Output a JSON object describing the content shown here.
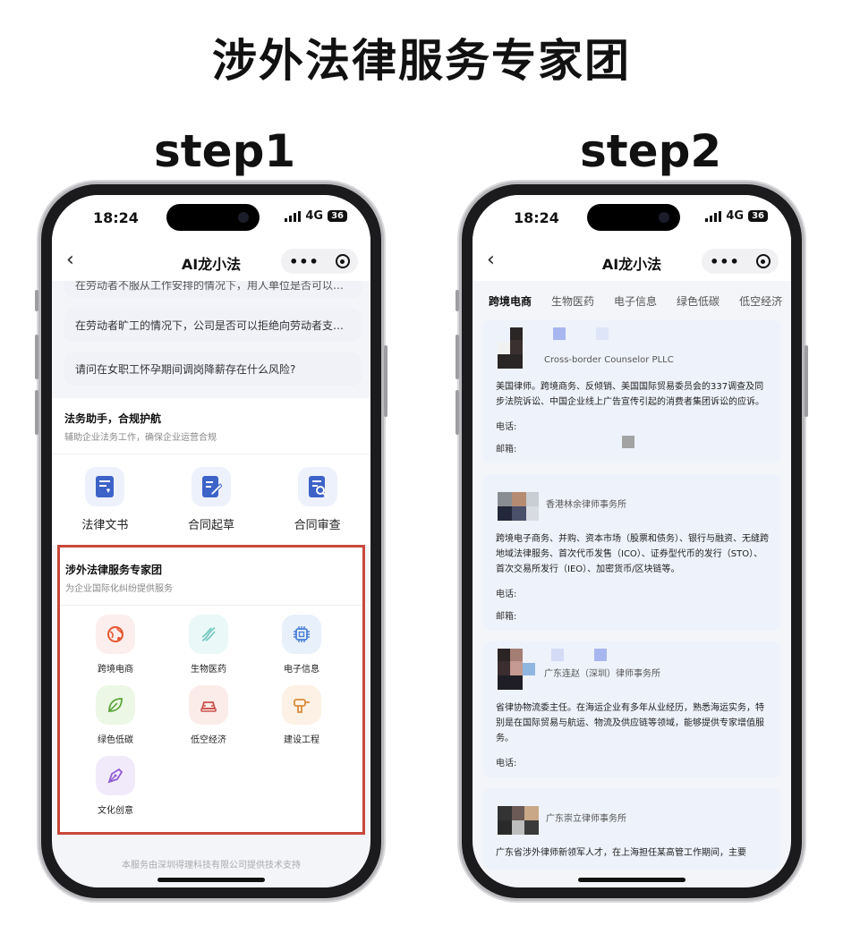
{
  "header": {
    "title": "涉外法律服务专家团",
    "step1": "step1",
    "step2": "step2"
  },
  "status_bar": {
    "time": "18:24",
    "network": "4G",
    "battery": "36"
  },
  "app": {
    "back_symbol": "‹",
    "title": "AI龙小法",
    "more_symbol": "•••"
  },
  "step1": {
    "question_partial": "在劳动者不服从工作安排的情况下，用人单位是否可以解…",
    "questions": [
      "在劳动者旷工的情况下，公司是否可以拒绝向劳动者支付…",
      "请问在女职工怀孕期间调岗降薪存在什么风险?"
    ],
    "assistant": {
      "title": "法务助手，合规护航",
      "subtitle": "辅助企业法务工作，确保企业运营合规",
      "tools": [
        {
          "label": "法律文书",
          "icon": "legal-document-icon"
        },
        {
          "label": "合同起草",
          "icon": "contract-draft-icon"
        },
        {
          "label": "合同审查",
          "icon": "contract-review-icon"
        }
      ]
    },
    "experts": {
      "title": "涉外法律服务专家团",
      "subtitle": "为企业国际化纠纷提供服务",
      "items": [
        {
          "label": "跨境电商",
          "icon": "globe-cart-icon",
          "color": "#e8572f",
          "bg": "#fdeeee"
        },
        {
          "label": "生物医药",
          "icon": "dna-icon",
          "color": "#7ac9c4",
          "bg": "#eaf8f7"
        },
        {
          "label": "电子信息",
          "icon": "chip-icon",
          "color": "#4a7fd6",
          "bg": "#e8f0fc"
        },
        {
          "label": "绿色低碳",
          "icon": "leaf-icon",
          "color": "#5aa63a",
          "bg": "#ecf7e5"
        },
        {
          "label": "低空经济",
          "icon": "aircraft-icon",
          "color": "#c9514a",
          "bg": "#fbecea"
        },
        {
          "label": "建设工程",
          "icon": "drill-icon",
          "color": "#d98a3c",
          "bg": "#fcf1e4"
        },
        {
          "label": "文化创意",
          "icon": "pen-nib-icon",
          "color": "#8f5ad2",
          "bg": "#f1eafb"
        }
      ]
    },
    "footer": "本服务由深圳得理科技有限公司提供技术支持"
  },
  "step2": {
    "tabs": [
      "跨境电商",
      "生物医药",
      "电子信息",
      "绿色低碳",
      "低空经济"
    ],
    "active_tab": 0,
    "phone_label": "电话:",
    "email_label": "邮箱:",
    "firms": [
      {
        "name": "Cross-border Counselor PLLC",
        "desc": "美国律师。跨境商务、反倾销、美国国际贸易委员会的337调查及同步法院诉讼、中国企业线上广告宣传引起的消费者集团诉讼的应诉。",
        "has_email": true
      },
      {
        "name": "香港林余律师事务所",
        "desc": "跨境电子商务、并购、资本市场（股票和债务）、银行与融资、无缝跨地域法律服务、首次代币发售（ICO）、证券型代币的发行（STO）、首次交易所发行（IEO）、加密货币/区块链等。",
        "has_email": true
      },
      {
        "name": "广东连赵（深圳）律师事务所",
        "desc": "省律协物流委主任。在海运企业有多年从业经历，熟悉海运实务，特别是在国际贸易与航运、物流及供应链等领域，能够提供专家增值服务。",
        "has_email": false
      },
      {
        "name": "广东崇立律师事务所",
        "desc": "广东省涉外律师新领军人才，在上海担任某高管工作期间，主要",
        "has_email": false
      }
    ]
  }
}
